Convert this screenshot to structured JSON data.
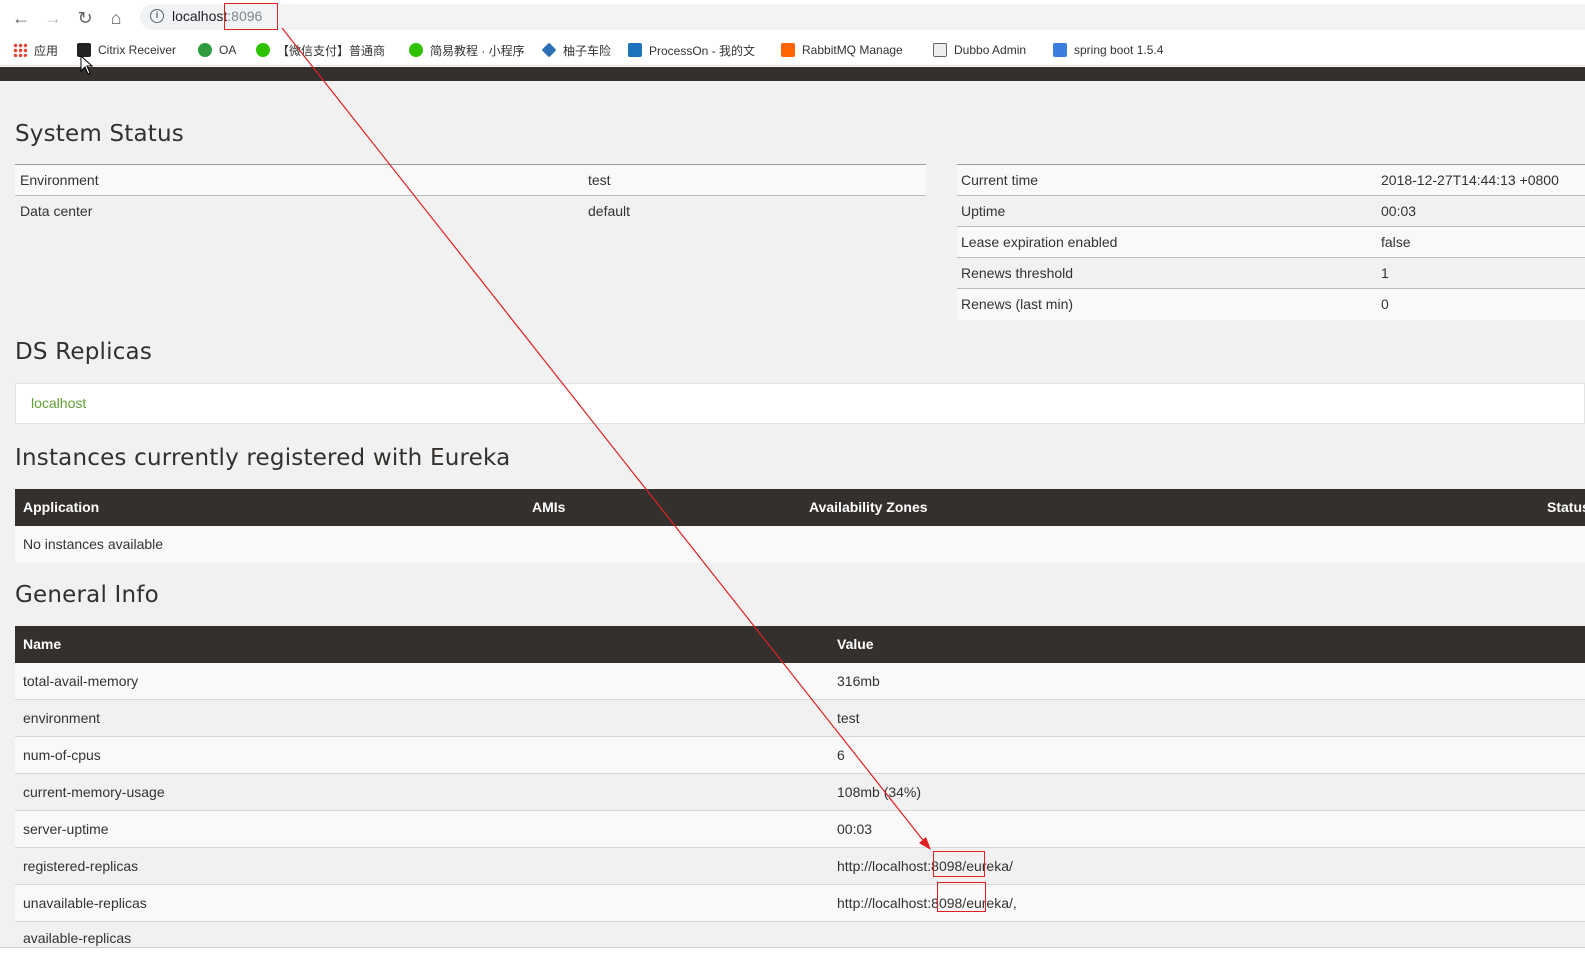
{
  "browser": {
    "url_host": "localhost",
    "url_port": ":8096",
    "bookmarks": [
      {
        "label": "应用",
        "icon": "apps-grid-icon",
        "color": "#4285f4"
      },
      {
        "label": "Citrix Receiver",
        "icon": "citrix-icon",
        "color": "#222222"
      },
      {
        "label": "OA",
        "icon": "gear-icon",
        "color": "#2e9c3f"
      },
      {
        "label": "【微信支付】普通商",
        "icon": "wechat-icon",
        "color": "#2dc100"
      },
      {
        "label": "简易教程 · 小程序",
        "icon": "wechat-icon",
        "color": "#2dc100"
      },
      {
        "label": "柚子车险",
        "icon": "diamond-icon",
        "color": "#2d6fb5"
      },
      {
        "label": "ProcessOn - 我的文",
        "icon": "processon-icon",
        "color": "#1e73be"
      },
      {
        "label": "RabbitMQ Manage",
        "icon": "rabbitmq-icon",
        "color": "#ff6600"
      },
      {
        "label": "Dubbo Admin",
        "icon": "dubbo-icon",
        "color": "#666666"
      },
      {
        "label": "spring boot 1.5.4 ",
        "icon": "document-icon",
        "color": "#3b7ddd"
      }
    ]
  },
  "system_status": {
    "title": "System Status",
    "left": [
      {
        "name": "Environment",
        "value": "test"
      },
      {
        "name": "Data center",
        "value": "default"
      }
    ],
    "right": [
      {
        "name": "Current time",
        "value": "2018-12-27T14:44:13 +0800"
      },
      {
        "name": "Uptime",
        "value": "00:03"
      },
      {
        "name": "Lease expiration enabled",
        "value": "false"
      },
      {
        "name": "Renews threshold",
        "value": "1"
      },
      {
        "name": "Renews (last min)",
        "value": "0"
      }
    ]
  },
  "ds_replicas": {
    "title": "DS Replicas",
    "link": "localhost"
  },
  "instances": {
    "title": "Instances currently registered with Eureka",
    "columns": [
      "Application",
      "AMIs",
      "Availability Zones",
      "Status"
    ],
    "empty_text": "No instances available"
  },
  "general_info": {
    "title": "General Info",
    "columns": [
      "Name",
      "Value"
    ],
    "rows": [
      {
        "name": "total-avail-memory",
        "value": "316mb"
      },
      {
        "name": "environment",
        "value": "test"
      },
      {
        "name": "num-of-cpus",
        "value": "6"
      },
      {
        "name": "current-memory-usage",
        "value": "108mb (34%)"
      },
      {
        "name": "server-uptime",
        "value": "00:03"
      },
      {
        "name": "registered-replicas",
        "value": "http://localhost:8098/eureka/"
      },
      {
        "name": "unavailable-replicas",
        "value": "http://localhost:8098/eureka/,"
      },
      {
        "name": "available-replicas",
        "value": ""
      }
    ]
  },
  "colors": {
    "header_dark": "#34302d",
    "link_green": "#5fa134",
    "annotation_red": "#e02020"
  }
}
